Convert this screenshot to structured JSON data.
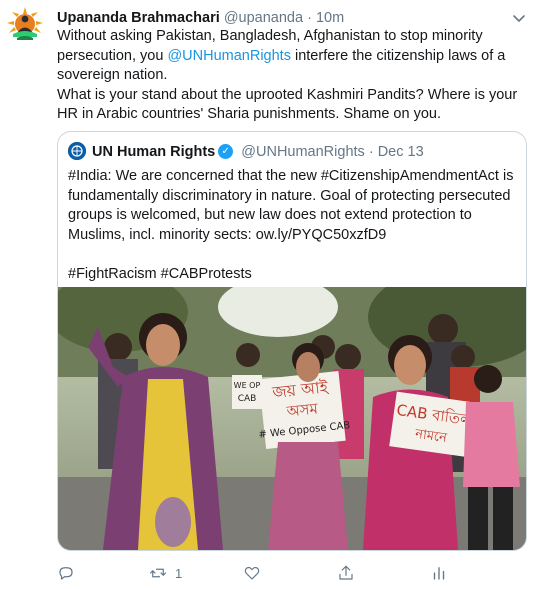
{
  "author": {
    "name": "Upananda Brahmachari",
    "handle": "@upananda",
    "separator": "·",
    "time": "10m"
  },
  "tweet": {
    "line1": "Without asking Pakistan, Bangladesh, Afghanistan to stop minority persecution, you ",
    "mention": "@UNHumanRights",
    "line1_end": " interfere the citizenship laws of a sovereign nation.",
    "line2": "What is your stand about the uprooted Kashmiri Pandits? Where is your HR in Arabic countries' Sharia punishments. Shame on you."
  },
  "quoted": {
    "name": "UN Human Rights",
    "handle": "@UNHumanRights",
    "separator": "·",
    "date": "Dec 13",
    "text1": "#India: We are concerned that the new #CitizenshipAmendmentAct is fundamentally discriminatory in nature. Goal of protecting persecuted groups is welcomed, but new law does not extend protection to Muslims, incl. minority sects: ow.ly/PYQC50xzfD9",
    "text2": "#FightRacism #CABProtests",
    "photo_signs": {
      "sign1": "জয় আই",
      "sign2": "অসম",
      "sign3": "# We Oppose CAB",
      "sign4": "CAB বাতিল",
      "sign5": "নামনে",
      "sign6": "WE OP",
      "sign7": "CAB"
    }
  },
  "actions": {
    "retweet_count": "1"
  },
  "icons": {
    "reply": "reply-icon",
    "retweet": "retweet-icon",
    "like": "heart-icon",
    "share": "share-icon",
    "analytics": "analytics-icon",
    "more": "chevron-down-icon"
  },
  "colors": {
    "link": "#1b95e0",
    "muted": "#657786",
    "verified": "#1da1f2"
  }
}
